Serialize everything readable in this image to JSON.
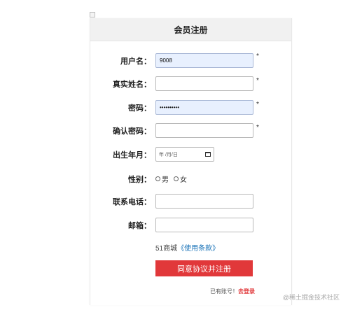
{
  "form": {
    "title": "会员注册",
    "username": {
      "label": "用户名：",
      "value": "9008",
      "required": "*"
    },
    "realname": {
      "label": "真实姓名：",
      "value": "",
      "required": "*"
    },
    "password": {
      "label": "密码：",
      "value": "••••••••••",
      "required": "*"
    },
    "confirm_password": {
      "label": "确认密码：",
      "value": "",
      "required": "*"
    },
    "birthdate": {
      "label": "出生年月：",
      "placeholder": "年 /月/日"
    },
    "gender": {
      "label": "性别：",
      "male": "男",
      "female": "女"
    },
    "phone": {
      "label": "联系电话：",
      "value": ""
    },
    "email": {
      "label": "邮箱：",
      "value": ""
    },
    "terms": {
      "prefix": "51商城",
      "link": "《使用条款》"
    },
    "submit_label": "同意协议并注册",
    "login": {
      "prefix": "已有账号！",
      "link": "去登录"
    }
  },
  "watermark": "@稀土掘金技术社区",
  "colors": {
    "accent": "#e1383a",
    "link": "#1a73b8",
    "autofill": "#e8f0fe"
  },
  "icons": {
    "calendar": "calendar-icon",
    "broken_image": "broken-image-icon"
  }
}
